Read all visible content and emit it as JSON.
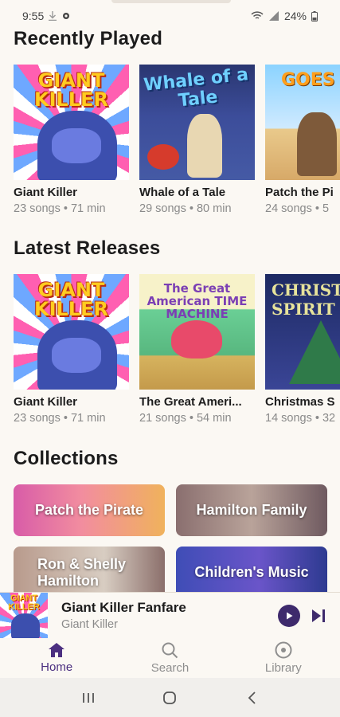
{
  "status_bar": {
    "time": "9:55",
    "battery": "24%",
    "icons": [
      "download-icon",
      "gear-icon",
      "wifi-icon",
      "signal-icon",
      "battery-icon"
    ]
  },
  "recently_played": {
    "heading": "Recently Played",
    "items": [
      {
        "name": "Giant Killer",
        "meta": "23 songs • 71 min",
        "art_title": "GIANT KILLER"
      },
      {
        "name": "Whale of a Tale",
        "meta": "29 songs • 80 min",
        "art_title": "Whale of a Tale"
      },
      {
        "name": "Patch the Pi",
        "meta": "24 songs • 5",
        "art_title": "GOES W"
      }
    ]
  },
  "latest_releases": {
    "heading": "Latest Releases",
    "items": [
      {
        "name": "Giant Killer",
        "meta": "23 songs • 71 min",
        "art_title": "GIANT KILLER"
      },
      {
        "name": "The Great Ameri...",
        "meta": "21 songs • 54 min",
        "art_title": "The Great American TIME MACHINE"
      },
      {
        "name": "Christmas S",
        "meta": "14 songs • 32",
        "art_title": "CHRISTMAS SPIRIT"
      }
    ]
  },
  "collections": {
    "heading": "Collections",
    "items": [
      {
        "label": "Patch the Pirate"
      },
      {
        "label": "Hamilton Family"
      },
      {
        "label": "Ron & Shelly Hamilton"
      },
      {
        "label": "Children's Music"
      }
    ]
  },
  "mini_player": {
    "track": "Giant Killer Fanfare",
    "album": "Giant Killer",
    "thumb_title": "GIANT KILLER"
  },
  "tabs": [
    {
      "label": "Home",
      "icon": "home-icon",
      "active": true
    },
    {
      "label": "Search",
      "icon": "search-icon",
      "active": false
    },
    {
      "label": "Library",
      "icon": "library-icon",
      "active": false
    }
  ],
  "colors": {
    "accent": "#4b2f80",
    "background": "#fbf8f3",
    "muted_text": "#8a8a8a"
  }
}
